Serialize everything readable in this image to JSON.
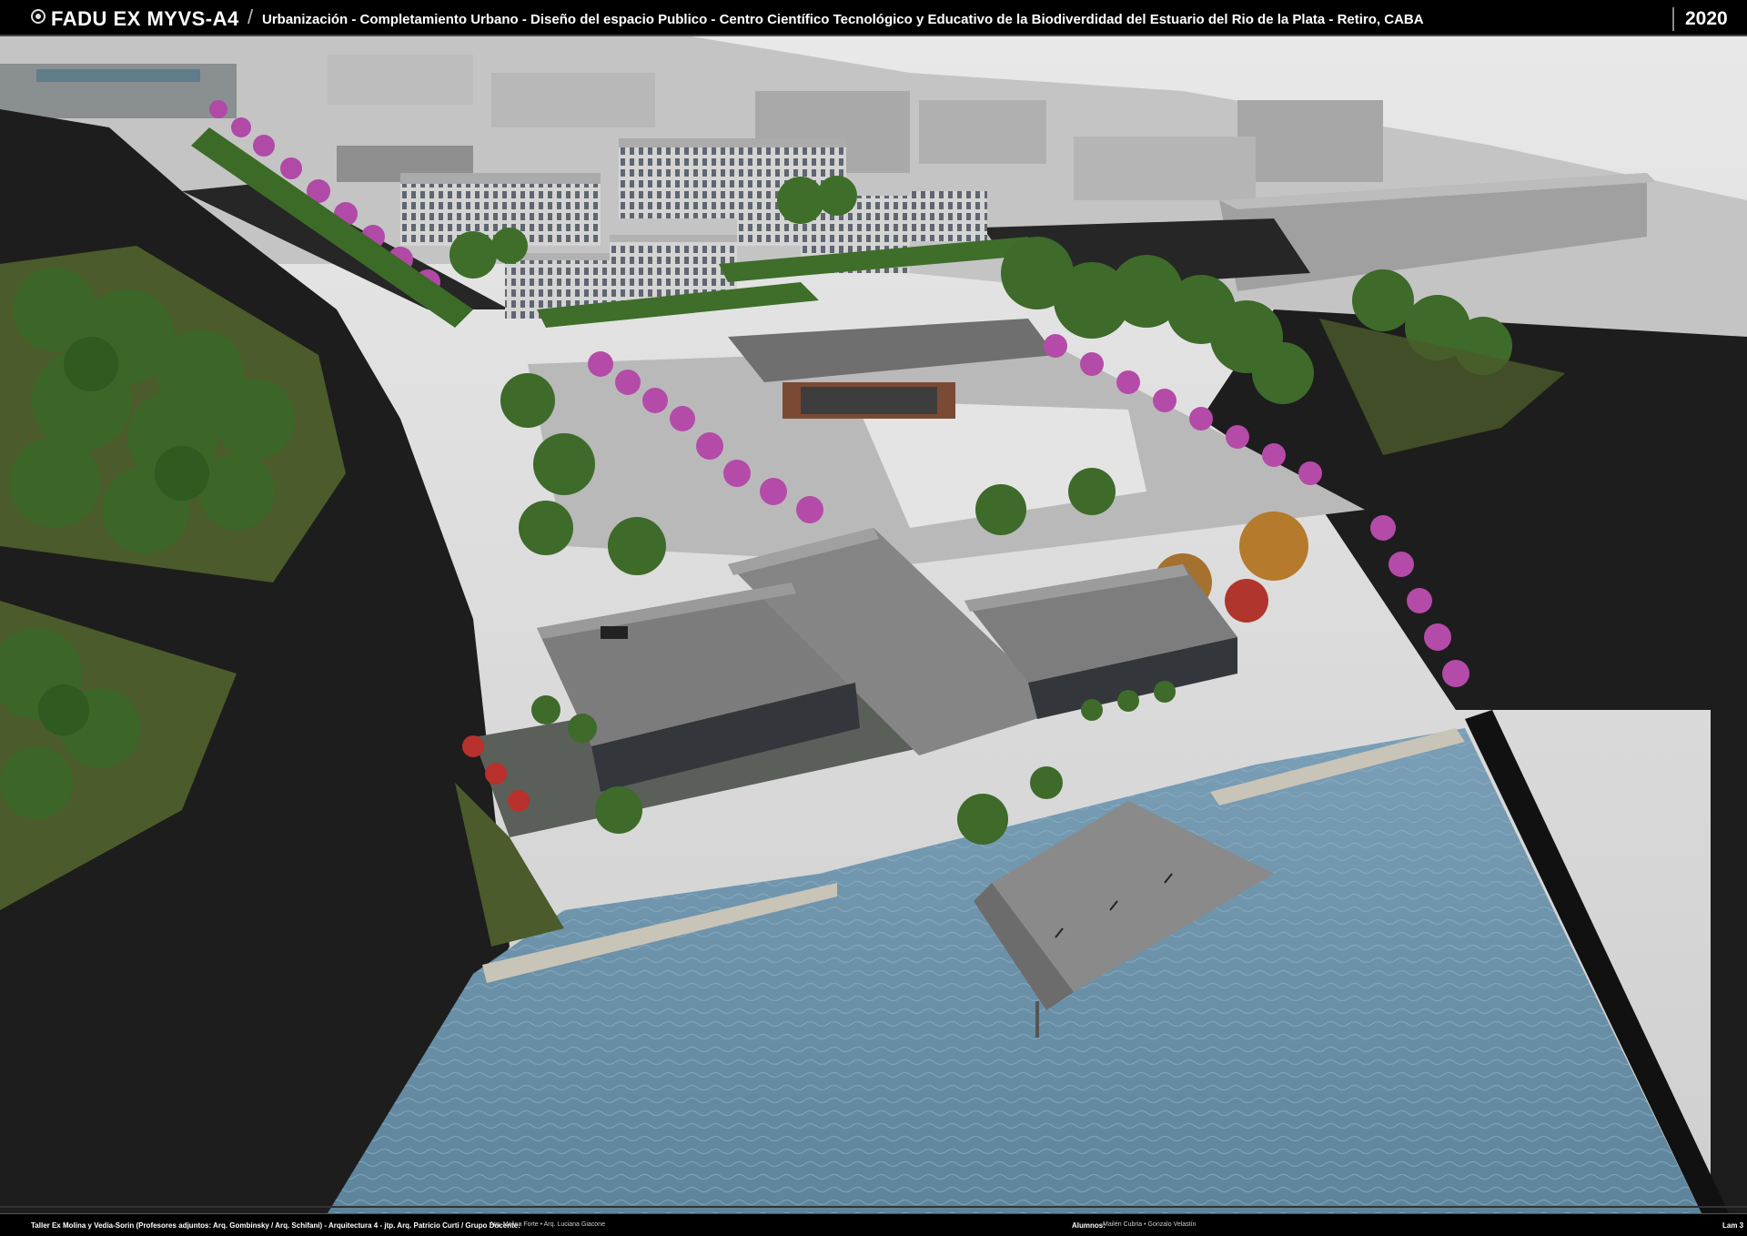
{
  "header": {
    "brand": "FADU EX MYVS-A4",
    "separator": "/",
    "subtitle": "Urbanización - Completamiento Urbano - Diseño del espacio Publico - Centro Científico Tecnológico y Educativo de la Biodiverdidad del Estuario del Rio de la Plata   - Retiro, CABA",
    "year": "2020",
    "logo_icon": "circle-logo-icon"
  },
  "render": {
    "description_icon": "architectural-aerial-render-image",
    "colors": {
      "sky": "#d9d9d9",
      "water": "#6f94aa",
      "asphalt": "#1c1c1c",
      "grass": "#4a5a2a",
      "tree": "#3e6a2a",
      "blossom": "#b34aa8",
      "building": "#9a9a9a",
      "roof": "#6e6e6e",
      "plaza": "#c8c8c8"
    }
  },
  "footer": {
    "credits": "Taller Ex Molina y Vedia-Sorin (Profesores adjuntos:  Arq. Gombinsky / Arq. Schifani) - Arquitectura 4 - jtp. Arq. Patricio Curti / Grupo Docente:",
    "docentes": "Arq. Melina Forte • Arq. Luciana Giacone",
    "alumnos_label": "Alumnos:",
    "alumnos": "Mailén Cubria • Gonzalo Velastín",
    "lam": "Lam 3"
  }
}
